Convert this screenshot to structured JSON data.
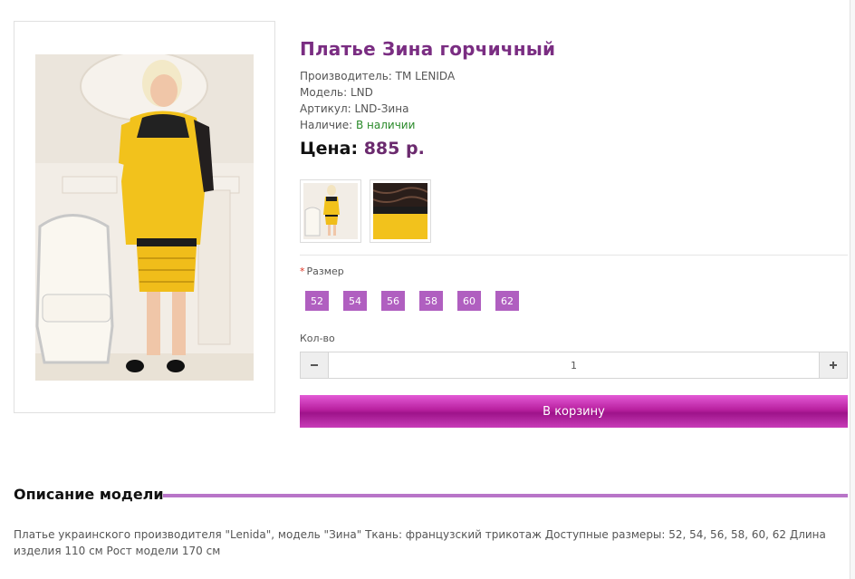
{
  "product": {
    "title": "Платье Зина горчичный",
    "manufacturer": "Производитель: ТМ LENIDA",
    "model": "Модель: LND",
    "article": "Артикул: LND-Зина",
    "availability_label": "Наличие: ",
    "availability_value": "В наличии",
    "price_label": "Цена:",
    "price_value": "885 р."
  },
  "options": {
    "size_required_mark": "*",
    "size_label": "Размер",
    "sizes": [
      "52",
      "54",
      "56",
      "58",
      "60",
      "62"
    ]
  },
  "quantity": {
    "label": "Кол-во",
    "value": "1",
    "minus_icon": "minus-icon",
    "plus_icon": "plus-icon"
  },
  "cart": {
    "button_label": "В корзину"
  },
  "description": {
    "heading": "Описание модели",
    "text": "Платье украинского производителя \"Lenida\", модель \"Зина\" Ткань: французский трикотаж Доступные размеры: 52, 54, 56, 58, 60, 62 Длина изделия 110 см Рост модели 170 см"
  },
  "colors": {
    "title": "#7a2d82",
    "price": "#6b2a6e",
    "in_stock": "#2a8a2a",
    "size_button": "#b05fc0",
    "cart_button": "#b8209f",
    "section_line": "#b875c8"
  }
}
